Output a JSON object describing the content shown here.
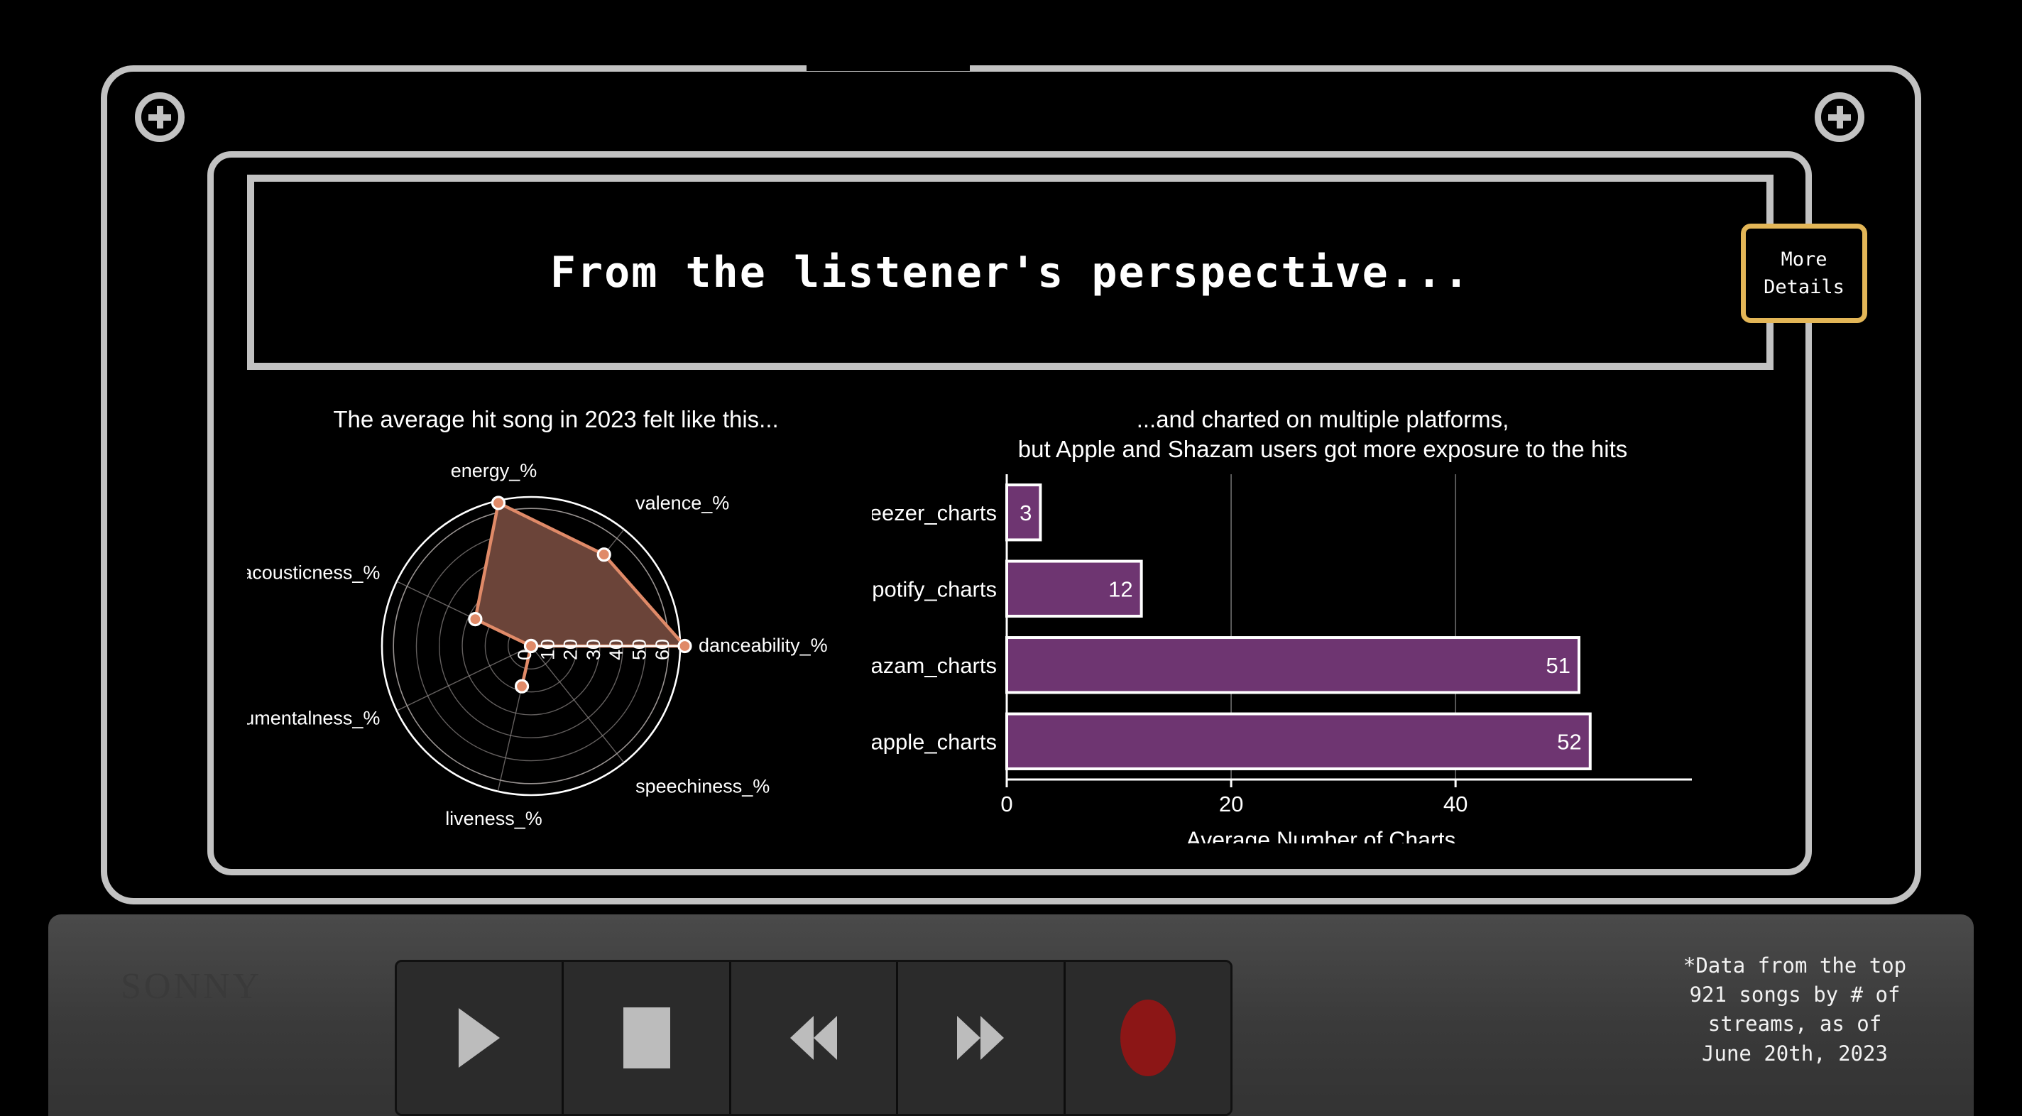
{
  "device": {
    "brand": "SONNY",
    "screws": [
      "screw-top-left",
      "screw-top-right"
    ]
  },
  "header": {
    "title": "From the listener's perspective...",
    "more_details_line1": "More",
    "more_details_line2": "Details",
    "more_details_border_color": "#e3b657"
  },
  "footnote": {
    "line1": "*Data from the top",
    "line2": "921 songs by # of",
    "line3": "streams, as of",
    "line4": "June 20th, 2023"
  },
  "transport": {
    "buttons": [
      {
        "name": "play-button",
        "icon": "play-icon"
      },
      {
        "name": "stop-button",
        "icon": "stop-icon"
      },
      {
        "name": "rewind-button",
        "icon": "rewind-icon"
      },
      {
        "name": "fast-forward-button",
        "icon": "fast-forward-icon"
      },
      {
        "name": "record-button",
        "icon": "record-icon"
      }
    ],
    "record_color": "#8c1616"
  },
  "chart_data": [
    {
      "type": "radar",
      "title": "The average hit song in 2023 felt like this...",
      "categories": [
        "danceability_%",
        "valence_%",
        "energy_%",
        "acousticness_%",
        "instrumentalness_%",
        "liveness_%",
        "speechiness_%"
      ],
      "values": [
        67,
        51,
        64,
        27,
        0,
        18,
        0
      ],
      "rlim": [
        0,
        65
      ],
      "rticks": [
        0,
        10,
        20,
        30,
        40,
        50,
        60
      ],
      "rtick_labels": [
        "0",
        "10",
        "20",
        "30",
        "40",
        "50",
        "60"
      ],
      "line_color": "#e08a68",
      "fill_color": "#6b4439",
      "grid_color": "#a09a98",
      "outer_ring_color": "#ffffff",
      "marker_color": "#e08a68",
      "marker_edge_color": "#ffffff",
      "grid": true,
      "legend": "none"
    },
    {
      "type": "bar",
      "orientation": "horizontal",
      "title_line1": "...and charted on multiple platforms,",
      "title_line2": "but Apple and Shazam users got more exposure to the hits",
      "categories": [
        "in_deezer_charts",
        "in_spotify_charts",
        "in_shazam_charts",
        "in_apple_charts"
      ],
      "values": [
        3,
        12,
        51,
        52
      ],
      "value_labels": [
        "3",
        "12",
        "51",
        "52"
      ],
      "xlabel": "Average Number of Charts",
      "ylabel": "",
      "xlim": [
        0,
        56
      ],
      "xticks": [
        0,
        20,
        40
      ],
      "xtick_labels": [
        "0",
        "20",
        "40"
      ],
      "bar_color": "#6e3571",
      "bar_edge_color": "#ffffff",
      "grid": true,
      "gridline_color": "#808080",
      "legend": "none"
    }
  ]
}
